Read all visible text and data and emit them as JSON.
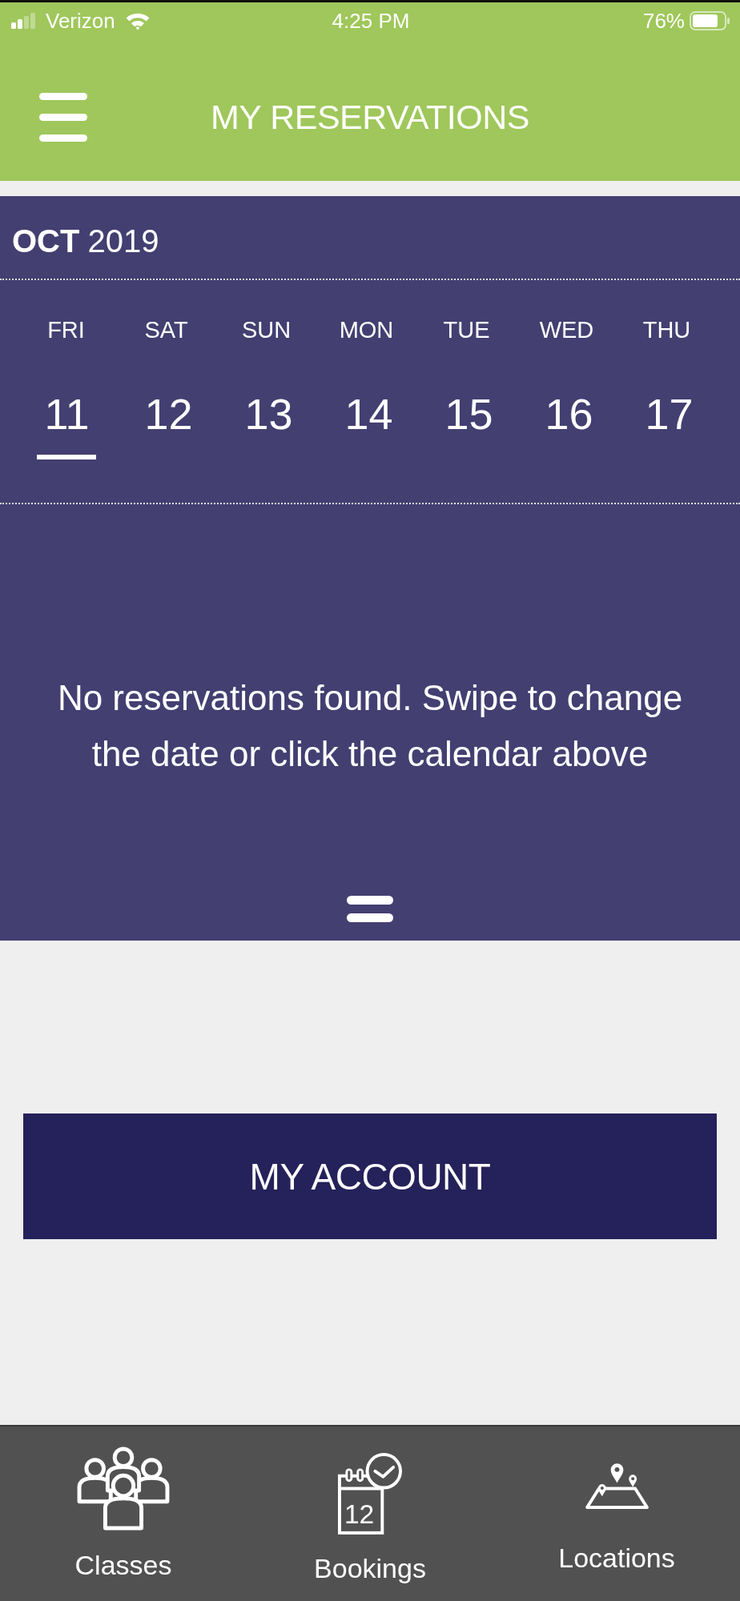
{
  "status_bar": {
    "carrier": "Verizon",
    "time": "4:25 PM",
    "battery": "76%"
  },
  "header": {
    "title": "MY RESERVATIONS"
  },
  "calendar": {
    "month": "OCT",
    "year": "2019",
    "days": [
      {
        "weekday": "FRI",
        "date": "11",
        "selected": true
      },
      {
        "weekday": "SAT",
        "date": "12",
        "selected": false
      },
      {
        "weekday": "SUN",
        "date": "13",
        "selected": false
      },
      {
        "weekday": "MON",
        "date": "14",
        "selected": false
      },
      {
        "weekday": "TUE",
        "date": "15",
        "selected": false
      },
      {
        "weekday": "WED",
        "date": "16",
        "selected": false
      },
      {
        "weekday": "THU",
        "date": "17",
        "selected": false
      }
    ]
  },
  "empty_message": "No reservations found. Swipe to change the date or click the calendar above",
  "account_button": {
    "label": "MY ACCOUNT"
  },
  "tab_bar": [
    {
      "kind": "classes",
      "label": "Classes"
    },
    {
      "kind": "bookings",
      "label": "Bookings",
      "icon_text": "12"
    },
    {
      "kind": "locations",
      "label": "Locations"
    }
  ]
}
